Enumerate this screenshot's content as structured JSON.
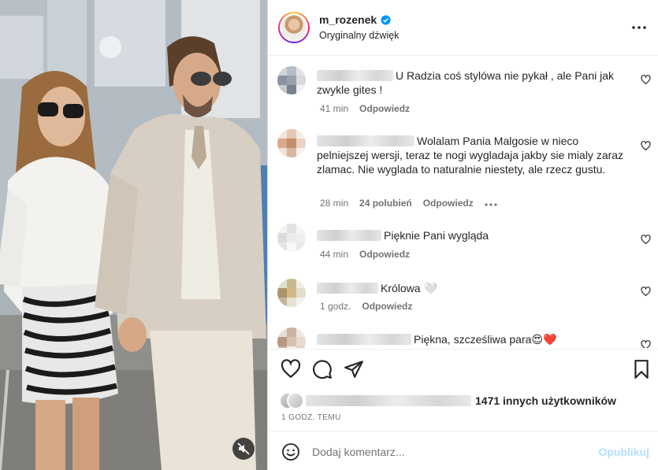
{
  "post": {
    "username": "m_rozenek",
    "audio": "Oryginalny dźwięk",
    "more_icon": "more-horizontal-icon",
    "verified_color": "#0095f6"
  },
  "comments": [
    {
      "text": "U Radzia coś stylówa nie pykał , ale Pani jak zwykle gites !",
      "time": "41 min",
      "likes": "",
      "reply": "Odpowiedz"
    },
    {
      "text": "Wolalam Pania Malgosie w nieco pelniejszej wersji, teraz te nogi wygladaja jakby sie mialy zaraz zlamac. Nie wyglada to naturalnie niestety, ale rzecz gustu.",
      "time": "28 min",
      "likes": "24 polubień",
      "reply": "Odpowiedz"
    },
    {
      "text": "Pięknie Pani wygląda",
      "time": "44 min",
      "likes": "",
      "reply": "Odpowiedz"
    },
    {
      "text": "Królowa 🤍",
      "time": "1 godz.",
      "likes": "",
      "reply": "Odpowiedz"
    },
    {
      "text": "Piękna, szcześliwa para😍❤️",
      "time": "",
      "likes": "",
      "reply": ""
    }
  ],
  "actions": {
    "likes_text": "1471 innych użytkowników",
    "timestamp": "1 GODZ. TEMU"
  },
  "composer": {
    "placeholder": "Dodaj komentarz...",
    "publish_label": "Opublikuj",
    "publish_color": "#b2dffc"
  }
}
